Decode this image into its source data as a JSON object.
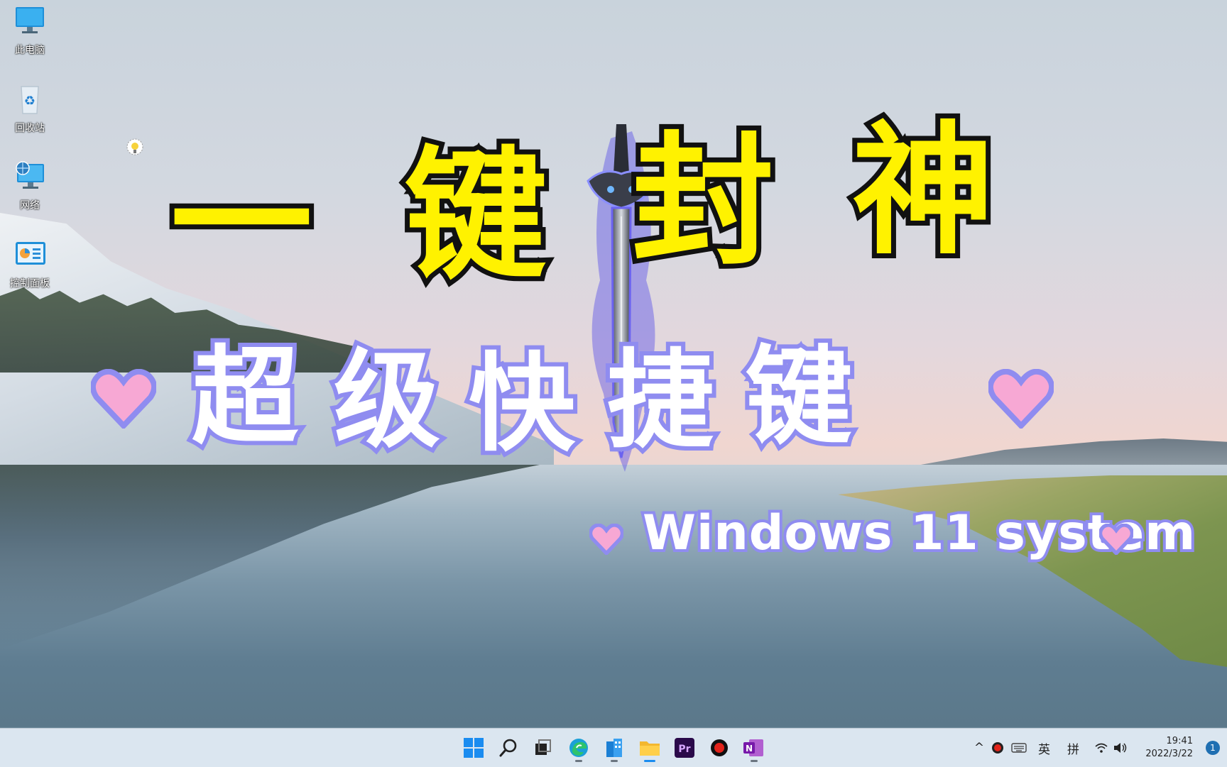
{
  "desktop": {
    "icons": [
      {
        "label": "此电脑",
        "icon": "this-pc-icon"
      },
      {
        "label": "回收站",
        "icon": "recycle-bin-icon"
      },
      {
        "label": "网络",
        "icon": "network-icon"
      },
      {
        "label": "控制面板",
        "icon": "control-panel-icon"
      }
    ]
  },
  "overlay": {
    "title_chars": [
      "一",
      "键",
      "封",
      "神"
    ],
    "subtitle_chars": [
      "超",
      "级",
      "快",
      "捷",
      "键"
    ],
    "tagline": "Windows 11 system",
    "colors": {
      "title_fill": "#fff200",
      "title_stroke": "#111111",
      "subtitle_stroke": "#8f8cf0",
      "heart_fill": "#f7a8d4"
    }
  },
  "taskbar": {
    "apps": [
      {
        "name": "start",
        "icon": "windows-start-icon"
      },
      {
        "name": "search",
        "icon": "search-icon"
      },
      {
        "name": "task-view",
        "icon": "task-view-icon"
      },
      {
        "name": "edge",
        "icon": "edge-icon"
      },
      {
        "name": "widgets",
        "icon": "building-icon"
      },
      {
        "name": "file-explorer",
        "icon": "folder-icon"
      },
      {
        "name": "premiere",
        "icon": "premiere-icon",
        "label": "Pr"
      },
      {
        "name": "recorder",
        "icon": "record-icon"
      },
      {
        "name": "onenote",
        "icon": "onenote-icon",
        "label": "N"
      }
    ],
    "tray": {
      "chevron": "^",
      "ime_lang": "英",
      "ime_mode": "拼",
      "time": "19:41",
      "date": "2022/3/22",
      "notification_count": "1"
    }
  }
}
